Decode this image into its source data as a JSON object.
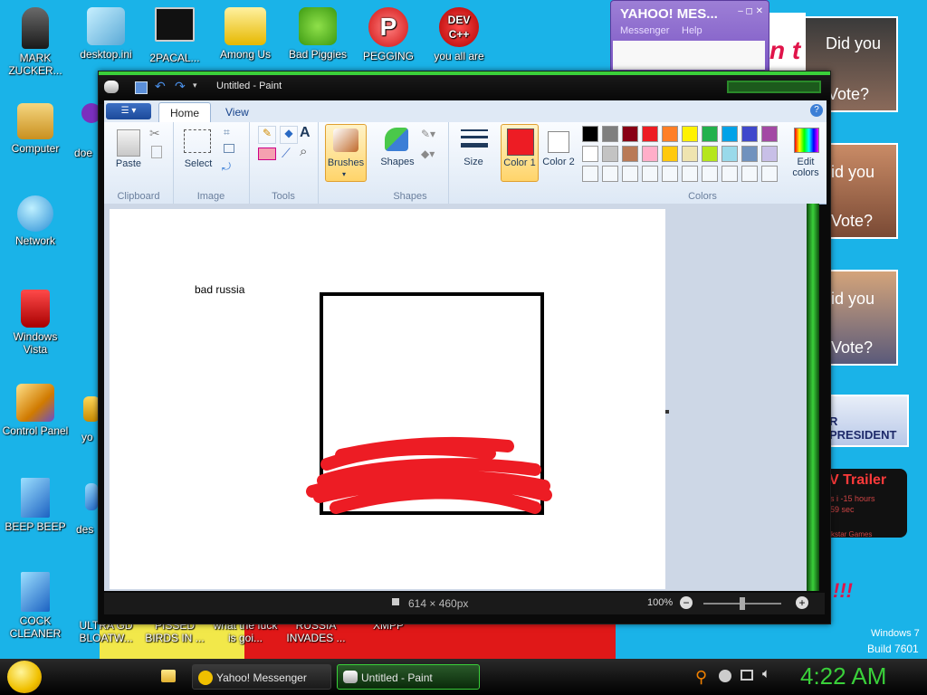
{
  "desktop": {
    "icons_left": [
      {
        "label": "MARK ZUCKER..."
      },
      {
        "label": "Computer"
      },
      {
        "label": "Network"
      },
      {
        "label": "Windows Vista"
      },
      {
        "label": "Control Panel"
      },
      {
        "label": "BEEP BEEP"
      },
      {
        "label": "COCK CLEANER"
      }
    ],
    "icons_top": [
      {
        "label": "desktop.ini"
      },
      {
        "label": "2PACAL..."
      },
      {
        "label": "Among Us"
      },
      {
        "label": "Bad Piggies"
      },
      {
        "label": "PEGGING"
      },
      {
        "label": "you all are"
      }
    ],
    "icons_col2": [
      {
        "label": "doe"
      },
      {
        "label": "yo"
      },
      {
        "label": "des"
      }
    ],
    "icons_bottom": [
      {
        "label": "ULTRA GD BLOATW..."
      },
      {
        "label": "PISSED BIRDS IN ..."
      },
      {
        "label": "what the fuck is goi..."
      },
      {
        "label": "RUSSIA INVADES ..."
      },
      {
        "label": "XMPP"
      }
    ],
    "gadget_texts": [
      "Did you",
      "Vote?",
      "id you",
      "Vote?",
      "id you",
      "Vote?"
    ],
    "president_text": "R PRESIDENT",
    "trailer_text": "V Trailer",
    "trailer_sub1": "rs i -15 hours",
    "trailer_sub2": "-59 sec",
    "trailer_sub3": "ckstar Games",
    "pink_text": "n t",
    "excl_text": "!!!",
    "watermark_line1": "Windows 7",
    "watermark_line2": "Build 7601"
  },
  "yahoo": {
    "title": "YAHOO! MES...",
    "menu_messenger": "Messenger",
    "menu_help": "Help"
  },
  "paint": {
    "title": "Untitled - Paint",
    "tabs": [
      {
        "label": "Home"
      },
      {
        "label": "View"
      }
    ],
    "groups": {
      "clipboard": "Clipboard",
      "image": "Image",
      "tools": "Tools",
      "shapes": "Shapes",
      "colors": "Colors"
    },
    "buttons": {
      "paste": "Paste",
      "select": "Select",
      "brushes": "Brushes",
      "shapes": "Shapes",
      "size": "Size",
      "color1": "Color 1",
      "color2": "Color 2",
      "edit_colors": "Edit colors"
    },
    "palette_row1": [
      "#000000",
      "#7f7f7f",
      "#880015",
      "#ed1c24",
      "#ff7f27",
      "#fff200",
      "#22b14c",
      "#00a2e8",
      "#3f48cc",
      "#a349a4"
    ],
    "palette_row2": [
      "#ffffff",
      "#c3c3c3",
      "#b97a57",
      "#ffaec9",
      "#ffc90e",
      "#efe4b0",
      "#b5e61d",
      "#99d9ea",
      "#7092be",
      "#c8bfe7"
    ],
    "color1": "#ed1c24",
    "color2": "#ffffff",
    "canvas_text": "bad russia",
    "status_size": "614 × 460px",
    "zoom": "100%"
  },
  "taskbar": {
    "items": [
      {
        "label": "Yahoo! Messenger"
      },
      {
        "label": "Untitled - Paint"
      }
    ],
    "clock": "4:22 AM"
  }
}
